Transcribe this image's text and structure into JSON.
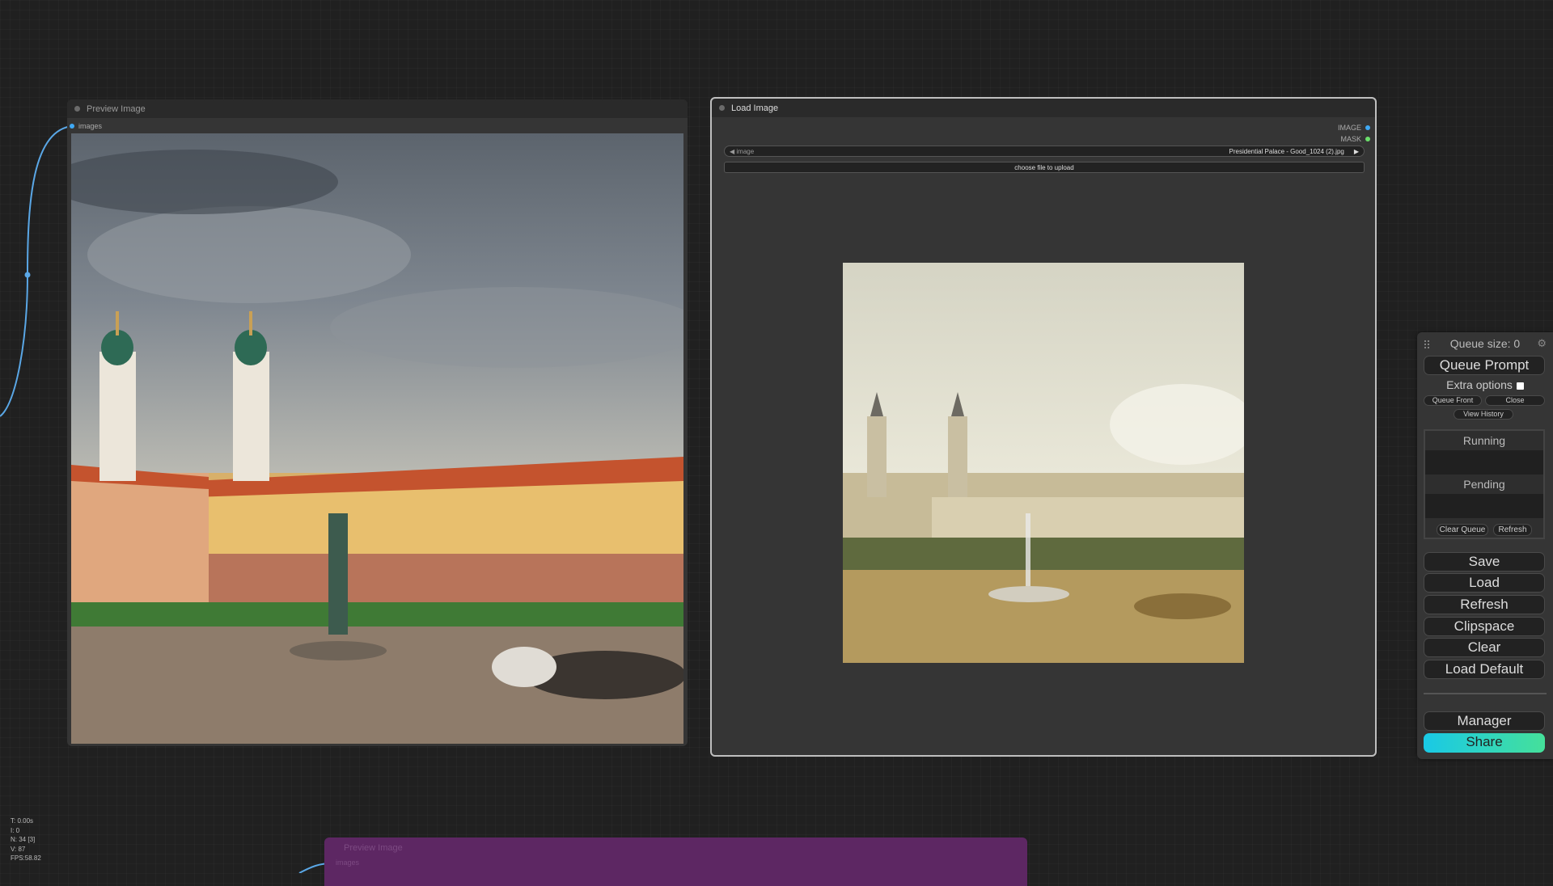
{
  "preview_node": {
    "title": "Preview Image",
    "input_label": "images"
  },
  "load_node": {
    "title": "Load Image",
    "outputs": [
      "IMAGE",
      "MASK"
    ],
    "image_widget": {
      "label": "image",
      "value": "Presidential Palace - Good_1024 (2).jpg"
    },
    "upload_label": "choose file to upload"
  },
  "menu": {
    "queue_size": "Queue size: 0",
    "queue_prompt": "Queue Prompt",
    "extra_options": "Extra options",
    "queue_front": "Queue Front",
    "close": "Close",
    "view_history": "View History",
    "running": "Running",
    "pending": "Pending",
    "clear_queue": "Clear Queue",
    "refresh_small": "Refresh",
    "buttons": [
      "Save",
      "Load",
      "Refresh",
      "Clipspace",
      "Clear",
      "Load Default"
    ],
    "manager": "Manager",
    "share": "Share"
  },
  "stats": [
    "T: 0.00s",
    "I: 0",
    "N: 34 [3]",
    "V: 87",
    "FPS:58.82"
  ],
  "ghost_node": {
    "title": "Preview Image",
    "input_label": "images"
  },
  "colors": {
    "image_slot": "#3fa9f5",
    "mask_slot": "#6be06b",
    "link": "#5aa7e6"
  }
}
